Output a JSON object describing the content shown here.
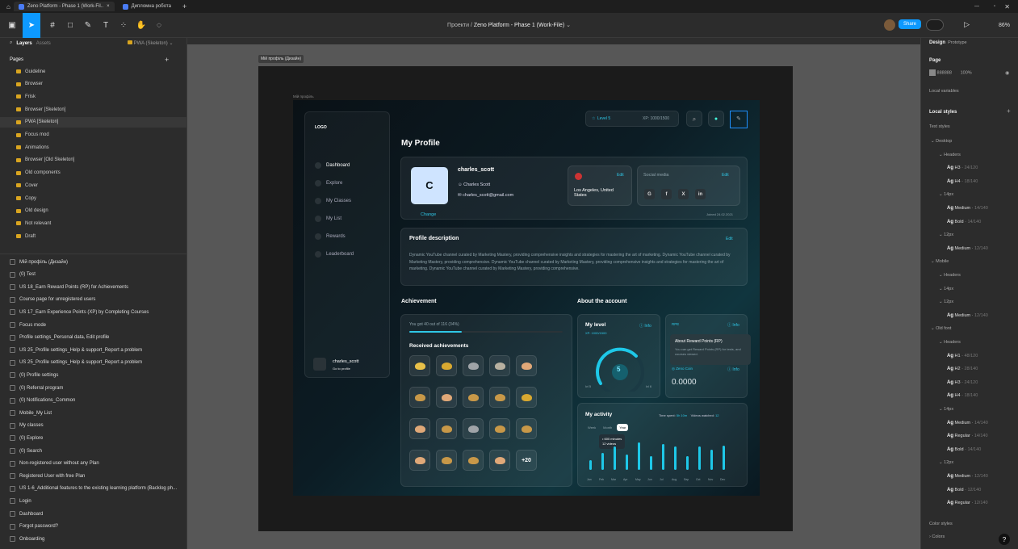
{
  "tabs": [
    {
      "label": "Zeno Platform - Phase 1 (Work-Fil.."
    },
    {
      "label": "Дипломна робота"
    }
  ],
  "toolbar": {
    "crumb_project": "Проекти",
    "crumb_separator": "/",
    "crumb_file": "Zeno Platform - Phase 1 (Work-File)",
    "share_label": "Share",
    "zoom": "86%"
  },
  "left_panel": {
    "layers_tab": "Layers",
    "assets_tab": "Assets",
    "page_selector": "PWA (Skeleton)",
    "pages_heading": "Pages",
    "pages": [
      "Guideline",
      "Browser",
      "Frisk",
      "Browser [Skeleton]",
      "PWA [Skeleton]",
      "Focus mod",
      "Animations",
      "Browser [Old Skeleton]",
      "Old components",
      "Cover",
      "Copy",
      "Old design",
      "Not relevant",
      "Draft"
    ],
    "layers": [
      "Мій профіль (Дизайн)",
      "(0) Test",
      "US 18_Earn Reward Points (RP) for Achievements",
      "Course page for unregistered users",
      "US 17_Earn Experience Points (XP) by Completing Courses",
      "Focus mode",
      "Profile settings_Personal data, Edit profile",
      "US 25_Profile settings_Help & support_Report a problem",
      "US 25_Profile settings_Help & support_Report a problem",
      "(0) Profile settings",
      "(0) Referral program",
      "(0) Notifications_Common",
      "Mobile_My List",
      "My classes",
      "(0) Explore",
      "(0) Search",
      "Non-registered user without any Plan",
      "Registered User with free Plan",
      "US 1-6_Additional features to the existing learning platform (Backlog ph...",
      "Login",
      "Dashboard",
      "Forgot password?",
      "Onboarding"
    ]
  },
  "right_panel": {
    "design_tab": "Design",
    "prototype_tab": "Prototype",
    "page_label": "Page",
    "page_color": "888888",
    "page_opacity": "100%",
    "local_variables": "Local variables",
    "local_styles": "Local styles",
    "text_styles": "Text styles",
    "styles": [
      {
        "t": "g",
        "label": "Desktop"
      },
      {
        "t": "s",
        "label": "Headers"
      },
      {
        "t": "i",
        "name": "H3",
        "val": "24/120"
      },
      {
        "t": "i",
        "name": "H4",
        "val": "18/140"
      },
      {
        "t": "s",
        "label": "14px"
      },
      {
        "t": "i",
        "name": "Medium",
        "val": "14/140"
      },
      {
        "t": "i",
        "name": "Bold",
        "val": "14/140"
      },
      {
        "t": "s",
        "label": "12px"
      },
      {
        "t": "i",
        "name": "Medium",
        "val": "12/140"
      },
      {
        "t": "g",
        "label": "Mobile"
      },
      {
        "t": "s",
        "label": "Headers"
      },
      {
        "t": "s",
        "label": "14px"
      },
      {
        "t": "s",
        "label": "12px"
      },
      {
        "t": "i",
        "name": "Medium",
        "val": "12/140"
      },
      {
        "t": "g",
        "label": "Old font"
      },
      {
        "t": "s",
        "label": "Headers"
      },
      {
        "t": "i",
        "name": "H1",
        "val": "48/120"
      },
      {
        "t": "i",
        "name": "H2",
        "val": "28/140"
      },
      {
        "t": "i",
        "name": "H3",
        "val": "24/120"
      },
      {
        "t": "i",
        "name": "H4",
        "val": "18/140"
      },
      {
        "t": "s",
        "label": "14px"
      },
      {
        "t": "i",
        "name": "Medium",
        "val": "14/140"
      },
      {
        "t": "i",
        "name": "Regular",
        "val": "14/140"
      },
      {
        "t": "i",
        "name": "Bold",
        "val": "14/140"
      },
      {
        "t": "s",
        "label": "12px"
      },
      {
        "t": "i",
        "name": "Medium",
        "val": "12/140"
      },
      {
        "t": "i",
        "name": "Bold",
        "val": "12/140"
      },
      {
        "t": "i",
        "name": "Regular",
        "val": "12/140"
      }
    ],
    "color_styles": "Color styles",
    "colors_group": "Colors"
  },
  "canvas": {
    "frame_label": "Мій профіль (Дизайн)",
    "inner_label": "Мій профіль"
  },
  "app": {
    "logo": "LOGO",
    "level_label": "Level 5",
    "xp_label": "XP: 1000/1500",
    "nav": [
      "Dashboard",
      "Explore",
      "My Classes",
      "My List",
      "Rewards",
      "Leaderboard"
    ],
    "user_name": "charles_scott",
    "user_sub": "Go to profile",
    "page_title": "My Profile",
    "avatar_letter": "C",
    "change": "Change",
    "username": "charles_scott",
    "full_name": "Charles Scott",
    "email": "charles_scott@gmail.com",
    "location": "Los Angeles, United States",
    "edit": "Edit",
    "social_title": "Social media",
    "social": [
      "G",
      "f",
      "X",
      "in"
    ],
    "joined": "Joined 24.02.2021",
    "desc_title": "Profile description",
    "desc_text": "Dynamic YouTube channel curated by Marketing Mastery, providing comprehensive insights and strategies for mastering the art of marketing. Dynamic YouTube channel curated by Marketing Mastery, providing comprehensive. Dynamic YouTube channel curated by Marketing Mastery, providing comprehensive insights and strategies for mastering the art of marketing. Dynamic YouTube channel curated by Marketing Mastery, providing comprehensive.",
    "achievement_title": "Achievement",
    "ach_progress_text": "You got 40 out of 116 (34%)",
    "ach_progress": 0.34,
    "received_title": "Received achievements",
    "more": "+20",
    "about_title": "About the account",
    "my_level": "My level",
    "info": "Info",
    "level_xp": "XP: 1000/1500",
    "level_num": "5",
    "lvl_from": "lvl 5",
    "lvl_to": "lvl 6",
    "rp_label": "RPE",
    "tooltip_title": "About Reward Points (RP)",
    "tooltip_text": "You can get Reward Points (RP) for tests, and courses viewed.",
    "zeno_coin": "Zeno Coin",
    "coin_value": "0.0000",
    "activity_title": "My activity",
    "time_spent_label": "Time spent:",
    "time_spent": "5h 10m",
    "videos_label": "Videos watched:",
    "videos": "12",
    "periods": [
      "Week",
      "Month",
      "Year"
    ],
    "tip_minutes": "• 600 minutes",
    "tip_videos": "12 videos",
    "months": [
      "Jan",
      "Feb",
      "Mar",
      "Apr",
      "May",
      "Jun",
      "Jul",
      "Aug",
      "Sep",
      "Oct",
      "Nov",
      "Dec"
    ],
    "activity_values": [
      12,
      22,
      30,
      20,
      35,
      17,
      33,
      30,
      17,
      30,
      26,
      31
    ]
  }
}
